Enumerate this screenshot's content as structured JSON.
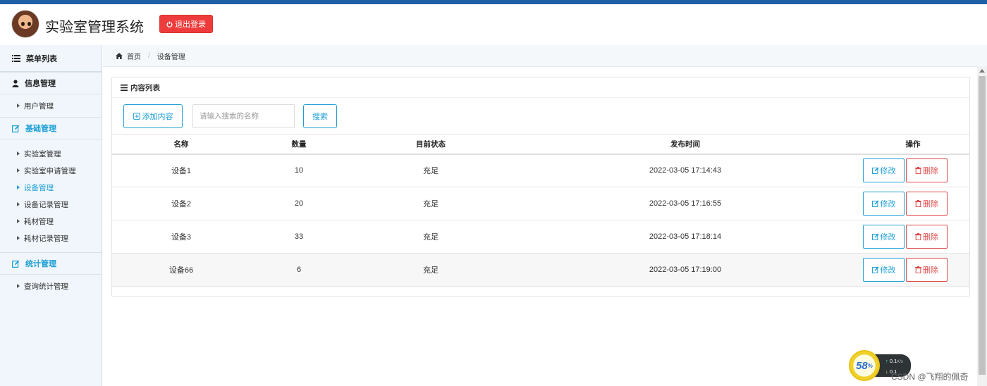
{
  "header": {
    "title": "实验室管理系统",
    "logout_label": "退出登录"
  },
  "sidebar": {
    "menu_title": "菜单列表",
    "groups": [
      {
        "label": "信息管理",
        "items": [
          {
            "label": "用户管理"
          }
        ]
      },
      {
        "label": "基础管理",
        "items": [
          {
            "label": "实验室管理"
          },
          {
            "label": "实验室申请管理"
          },
          {
            "label": "设备管理"
          },
          {
            "label": "设备记录管理"
          },
          {
            "label": "耗材管理"
          },
          {
            "label": "耗材记录管理"
          }
        ]
      },
      {
        "label": "统计管理",
        "items": [
          {
            "label": "查询统计管理"
          }
        ]
      }
    ],
    "active_item": "设备管理"
  },
  "breadcrumb": {
    "home": "首页",
    "current": "设备管理"
  },
  "panel": {
    "title": "内容列表",
    "add_label": "添加内容",
    "search_placeholder": "请输入搜索的名称",
    "search_label": "搜索"
  },
  "table": {
    "columns": [
      "名称",
      "数量",
      "目前状态",
      "发布时间",
      "操作"
    ],
    "rows": [
      {
        "name": "设备1",
        "qty": "10",
        "status": "充足",
        "time": "2022-03-05 17:14:43"
      },
      {
        "name": "设备2",
        "qty": "20",
        "status": "充足",
        "time": "2022-03-05 17:16:55"
      },
      {
        "name": "设备3",
        "qty": "33",
        "status": "充足",
        "time": "2022-03-05 17:18:14"
      },
      {
        "name": "设备66",
        "qty": "6",
        "status": "充足",
        "time": "2022-03-05 17:19:00"
      }
    ],
    "edit_label": "修改",
    "delete_label": "删除"
  },
  "speed_widget": {
    "percent": "58",
    "percent_sign": "%",
    "up": "0.1",
    "down": "0.1",
    "unit": "K/s"
  },
  "watermark": "CSDN @飞翔的佩奇",
  "colors": {
    "accent": "#1d9fd6",
    "danger": "#e04747",
    "topbar": "#1f5fa8",
    "logout": "#ee3b3b"
  }
}
